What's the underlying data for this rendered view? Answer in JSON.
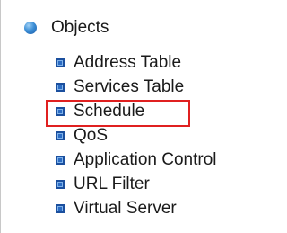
{
  "tree": {
    "section": {
      "label": "Objects",
      "icon": "bullet-circle-icon"
    },
    "items": [
      {
        "label": "Address Table"
      },
      {
        "label": "Services Table"
      },
      {
        "label": "Schedule"
      },
      {
        "label": "QoS"
      },
      {
        "label": "Application Control"
      },
      {
        "label": "URL Filter"
      },
      {
        "label": "Virtual Server"
      }
    ]
  },
  "highlight": {
    "target": "Schedule",
    "color": "#e02020"
  },
  "colors": {
    "bullet": "#2b6cc4",
    "text": "#1a1a1a"
  }
}
